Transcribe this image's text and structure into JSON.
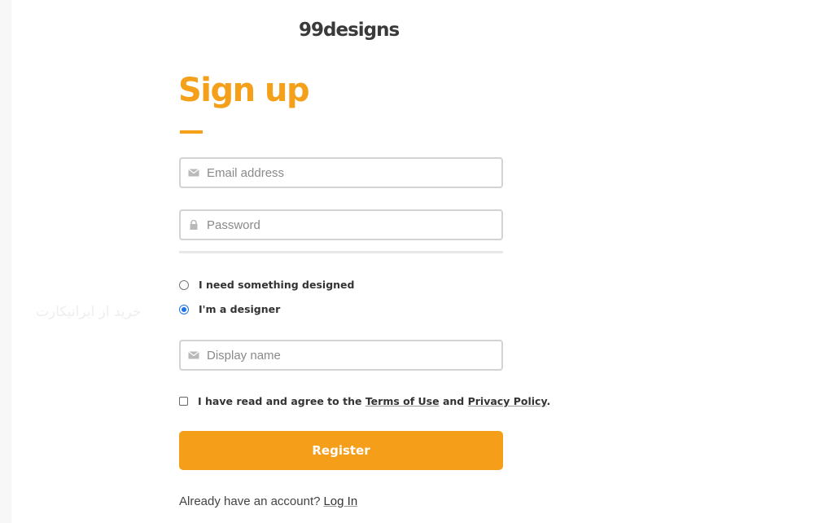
{
  "brand": {
    "logo": "99designs",
    "accent_color": "#f5a01a"
  },
  "form": {
    "title": "Sign up",
    "email": {
      "placeholder": "Email address",
      "icon": "envelope-icon"
    },
    "password": {
      "placeholder": "Password",
      "icon": "lock-icon"
    },
    "role_options": [
      {
        "label": "I need something designed",
        "checked": false
      },
      {
        "label": "I'm a designer",
        "checked": true
      }
    ],
    "display_name": {
      "placeholder": "Display name",
      "icon": "envelope-icon"
    },
    "terms": {
      "prefix": "I have read and agree to the",
      "terms_link": "Terms of Use",
      "and": "and",
      "privacy_link": "Privacy Policy",
      "suffix": ".",
      "checked": false
    },
    "submit_label": "Register",
    "footer_prompt": "Already have an account?",
    "footer_link": "Log In"
  },
  "watermark": "خرید از ایرانیکارت"
}
